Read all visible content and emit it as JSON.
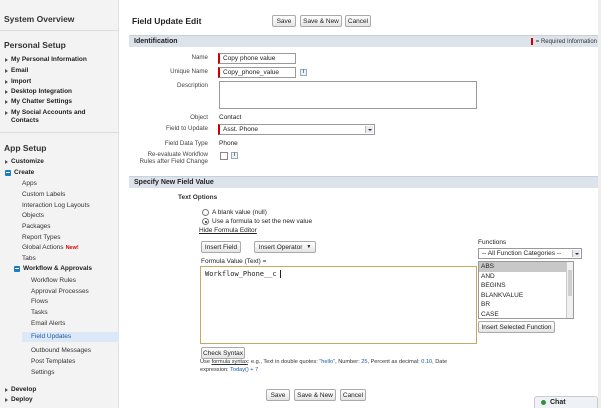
{
  "sidebar": {
    "system_overview": "System Overview",
    "personal_setup": "Personal Setup",
    "personal_items": [
      "My Personal Information",
      "Email",
      "Import",
      "Desktop Integration",
      "My Chatter Settings",
      "My Social Accounts and Contacts"
    ],
    "app_setup": "App Setup",
    "customize": "Customize",
    "create": "Create",
    "create_items": [
      "Apps",
      "Custom Labels",
      "Interaction Log Layouts",
      "Objects",
      "Packages",
      "Report Types",
      "Global Actions",
      "Tabs"
    ],
    "new_badge": "New!",
    "workflow": "Workflow & Approvals",
    "workflow_items": [
      "Workflow Rules",
      "Approval Processes",
      "Flows",
      "Tasks",
      "Email Alerts",
      "Field Updates",
      "Outbound Messages",
      "Post Templates",
      "Settings"
    ],
    "develop": "Develop",
    "deploy": "Deploy"
  },
  "header": {
    "title": "Field Update Edit",
    "save": "Save",
    "save_new": "Save & New",
    "cancel": "Cancel"
  },
  "identification": {
    "title": "Identification",
    "required_legend": "= Required Information",
    "name_label": "Name",
    "name_value": "Copy phone value",
    "unique_label": "Unique Name",
    "unique_value": "Copy_phone_value",
    "info_icon": "i",
    "description_label": "Description",
    "object_label": "Object",
    "object_value": "Contact",
    "field_label": "Field to Update",
    "field_value": "Asst. Phone",
    "datatype_label": "Field Data Type",
    "datatype_value": "Phone",
    "reeval_label_1": "Re-evaluate Workflow",
    "reeval_label_2": "Rules after Field Change"
  },
  "new_value": {
    "title": "Specify New Field Value",
    "text_options": "Text Options",
    "opt_blank": "A blank value (null)",
    "opt_formula": "Use a formula to set the new value",
    "hide_editor": "Hide Formula Editor",
    "insert_field": "Insert Field",
    "insert_operator": "Insert Operator",
    "formula_label": "Formula Value (Text) =",
    "formula_value": "Workflow_Phone__c",
    "functions_label": "Functions",
    "function_category": "-- All Function Categories --",
    "functions": [
      "ABS",
      "AND",
      "BEGINS",
      "BLANKVALUE",
      "BR",
      "CASE"
    ],
    "insert_function": "Insert Selected Function",
    "check_syntax": "Check Syntax",
    "help_use": "Use",
    "help_link": "formula syntax",
    "help_t1": ": e.g., Text in double quotes: ",
    "help_v1": "\"hello\"",
    "help_t2": ", Number: ",
    "help_v2": "25",
    "help_t3": ", Percent as decimal: ",
    "help_v3": "0.10",
    "help_t4": ", Date",
    "help_t5": "expression: ",
    "help_v5": "Today() + 7"
  },
  "footer": {
    "save": "Save",
    "save_new": "Save & New",
    "cancel": "Cancel"
  },
  "chat": {
    "label": "Chat"
  }
}
